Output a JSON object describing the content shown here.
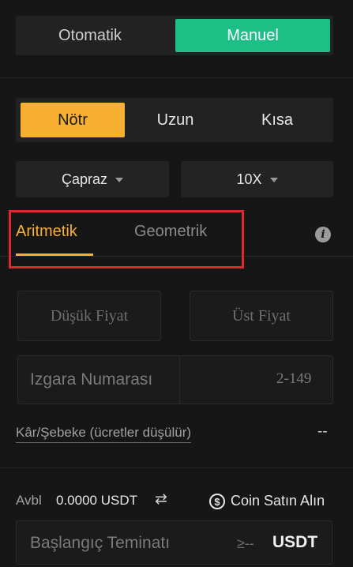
{
  "mode_toggle": {
    "left_label": "Otomatik",
    "right_label": "Manuel"
  },
  "direction": {
    "neutral": "Nötr",
    "long": "Uzun",
    "short": "Kısa"
  },
  "dropdowns": {
    "margin_mode": "Çapraz",
    "leverage": "10X"
  },
  "grid_type_tabs": {
    "arithmetic": "Aritmetik",
    "geometric": "Geometrik"
  },
  "price_inputs": {
    "lower_placeholder": "Düşük Fiyat",
    "upper_placeholder": "Üst Fiyat"
  },
  "grid_count": {
    "label": "Izgara Numarası",
    "range": "2-149"
  },
  "profit_per_grid": {
    "label": "Kâr/Şebeke (ücretler düşülür)",
    "value": "--"
  },
  "balance": {
    "label": "Avbl",
    "value": "0.0000 USDT",
    "swap_glyph": "⇄"
  },
  "buy_coin": {
    "icon_glyph": "$",
    "label": "Coin Satın Alın"
  },
  "initial_margin": {
    "label": "Başlangıç Teminatı",
    "min": "≥--",
    "unit": "USDT"
  },
  "colors": {
    "accent_green": "#1dbf87",
    "accent_yellow": "#f7b032",
    "highlight_red": "#e2262b"
  },
  "icons": [
    "caret-down-icon",
    "info-icon",
    "swap-icon",
    "dollar-coin-icon"
  ]
}
